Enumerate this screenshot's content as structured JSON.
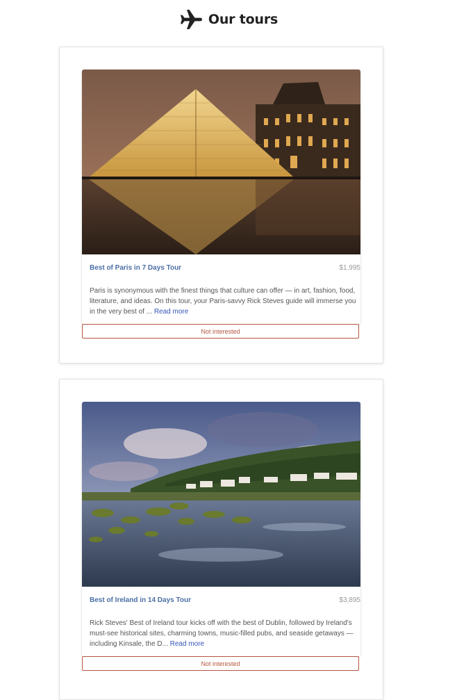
{
  "header": {
    "title": "Our tours",
    "icon": "airplane-icon"
  },
  "tours": [
    {
      "name": "Best of Paris in 7 Days Tour",
      "price": "$1,995",
      "description": "Paris is synonymous with the finest things that culture can offer — in art, fashion, food, literature, and ideas. On this tour, your Paris-savvy Rick Steves guide will immerse you in the very best of ...",
      "read_more": "Read more",
      "button": "Not interested"
    },
    {
      "name": "Best of Ireland in 14 Days Tour",
      "price": "$3,895",
      "description": "Rick Steves' Best of Ireland tour kicks off with the best of Dublin, followed by Ireland's must-see historical sites, charming towns, music-filled pubs, and seaside getaways — including Kinsale, the D...",
      "read_more": "Read more",
      "button": "Not interested"
    }
  ],
  "colors": {
    "title_link": "#4a6fa5",
    "read_more": "#3554b8",
    "button_border": "#b5553f"
  }
}
